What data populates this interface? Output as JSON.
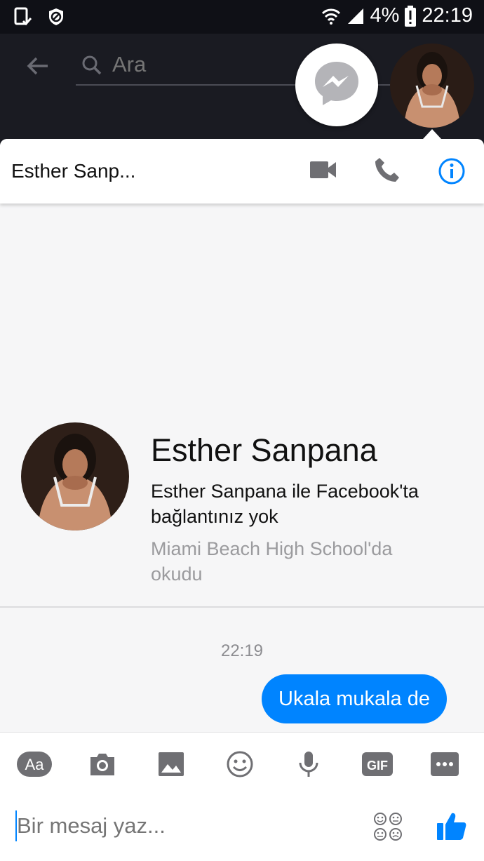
{
  "status_bar": {
    "battery": "4%",
    "time": "22:19",
    "left_icons": [
      "phone-notification-icon",
      "blocked-icon"
    ],
    "right_icons": [
      "wifi-icon",
      "signal-icon",
      "battery-alert-icon"
    ]
  },
  "search": {
    "placeholder": "Ara",
    "back_icon": "arrow-left-icon"
  },
  "chat_heads": {
    "messenger_icon": "messenger-icon",
    "avatar": "contact-avatar"
  },
  "conversation": {
    "title": "Esther Sanp...",
    "actions": [
      {
        "name": "video-call",
        "icon": "video-camera-icon"
      },
      {
        "name": "voice-call",
        "icon": "phone-icon"
      },
      {
        "name": "info",
        "icon": "info-icon"
      }
    ]
  },
  "profile": {
    "name": "Esther Sanpana",
    "connection": "Esther Sanpana ile Facebook'ta bağlantınız yok",
    "school": "Miami Beach High School'da okudu"
  },
  "messages": {
    "timestamp": "22:19",
    "items": [
      {
        "text": "Ukala mukala de",
        "outgoing": true
      }
    ]
  },
  "toolbar": {
    "items": [
      "text-format",
      "camera",
      "gallery",
      "emoji",
      "microphone",
      "gif",
      "more"
    ],
    "text_label": "Aa",
    "gif_label": "GIF"
  },
  "composer": {
    "placeholder": "Bir mesaj yaz..."
  },
  "colors": {
    "accent": "#0084ff",
    "icon_gray": "#6f6f73",
    "panel_bg": "#f6f6f7",
    "dark_bg": "#1a1b22"
  }
}
